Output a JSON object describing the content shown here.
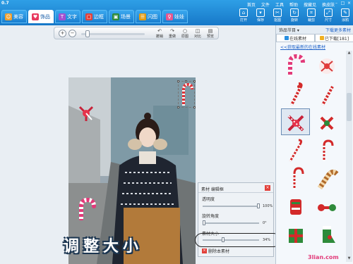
{
  "app": {
    "version": "0.7"
  },
  "title_menu": [
    "首页",
    "文件",
    "工具",
    "帮助",
    "搜藏见",
    "换皮肤"
  ],
  "window_buttons": [
    "–",
    "□",
    "×"
  ],
  "tabs": [
    {
      "label": "美容",
      "icon": "face-icon",
      "color": "#f0a030"
    },
    {
      "label": "饰品",
      "icon": "heart-icon",
      "color": "#e83a5e",
      "active": true
    },
    {
      "label": "文字",
      "icon": "text-icon",
      "color": "#a34fd0"
    },
    {
      "label": "边框",
      "icon": "frame-icon",
      "color": "#e2403a"
    },
    {
      "label": "场景",
      "icon": "scene-icon",
      "color": "#2c8a3a"
    },
    {
      "label": "闪图",
      "icon": "flash-icon",
      "color": "#e39b12"
    },
    {
      "label": "娃娃",
      "icon": "doll-icon",
      "color": "#e8578f"
    }
  ],
  "top_tools": [
    {
      "label": "打开",
      "icon": "open-icon"
    },
    {
      "label": "保存",
      "icon": "save-icon"
    },
    {
      "label": "抠图",
      "icon": "cutout-icon"
    },
    {
      "label": "旋转",
      "icon": "rotate-icon"
    },
    {
      "label": "裁剪",
      "icon": "crop-icon"
    },
    {
      "label": "尺寸",
      "icon": "resize-icon"
    },
    {
      "label": "涂鸦",
      "icon": "doodle-icon"
    }
  ],
  "edit_toolbar": {
    "zoom_in": "+",
    "zoom_out": "−",
    "tools": [
      {
        "label": "撤销",
        "glyph": "↶"
      },
      {
        "label": "重做",
        "glyph": "↷"
      },
      {
        "label": "原图",
        "glyph": "○"
      },
      {
        "label": "对比",
        "glyph": "◫"
      },
      {
        "label": "预览",
        "glyph": "▤"
      }
    ]
  },
  "material_panel": {
    "title": "素材 编辑框",
    "close": "×",
    "opacity_label": "透明度",
    "opacity_value": "100%",
    "opacity_level": 1.0,
    "angle_label": "旋转角度",
    "angle_value": "0°",
    "angle_level": 0.0,
    "size_label": "素材大小",
    "size_value": "34%",
    "size_level": 0.34,
    "delete_label": "删除本素材",
    "delete_icon": "×"
  },
  "overlay_caption": "调整大小",
  "watermark": "3lian.com",
  "right_panel": {
    "header_title": "饰品节目 ▾",
    "header_link": "下载更多素材",
    "tab_online": "在线素材",
    "tab_downloaded": "已下载[181]",
    "refresh_link": "<<获取最新的在线素材",
    "scroll_up": "▲",
    "scroll_down": "▼"
  }
}
